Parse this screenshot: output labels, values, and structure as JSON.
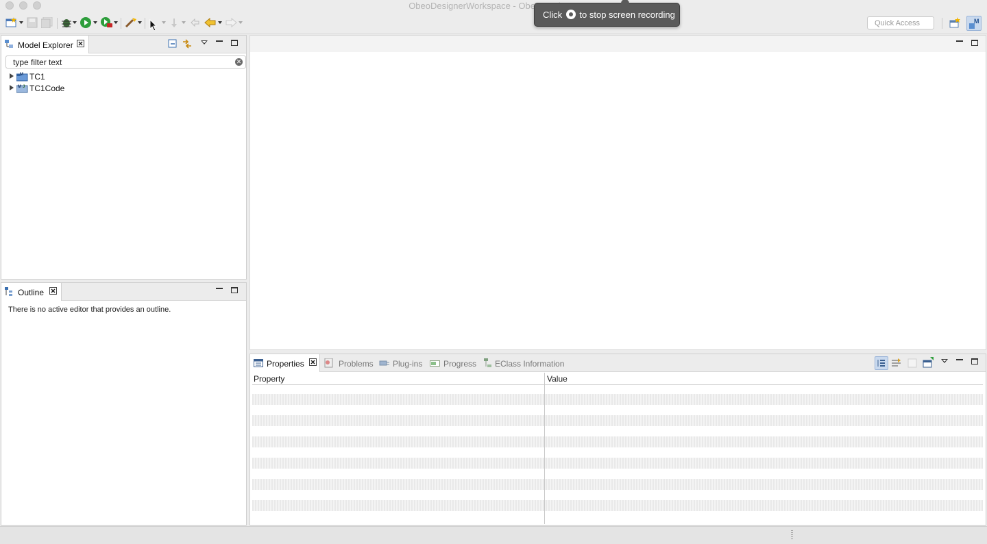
{
  "window": {
    "title": "ObeoDesignerWorkspace - Obeo Designer"
  },
  "recording_tip": {
    "before": "Click",
    "after": "to stop screen recording"
  },
  "toolbar": {
    "quick_access_placeholder": "Quick Access"
  },
  "model_explorer": {
    "tab_label": "Model Explorer",
    "filter_text": "type filter text",
    "items": [
      {
        "label": "TC1"
      },
      {
        "label": "TC1Code"
      }
    ]
  },
  "outline": {
    "tab_label": "Outline",
    "message": "There is no active editor that provides an outline."
  },
  "bottom_tabs": {
    "properties": "Properties",
    "problems": "Problems",
    "plugins": "Plug-ins",
    "progress": "Progress",
    "eclass_info": "EClass Information"
  },
  "properties_table": {
    "columns": [
      "Property",
      "Value"
    ]
  },
  "colors": {
    "accent": "#3a7fd4",
    "run_green": "#2e9e3c",
    "tooltip_bg": "#5a5a5a"
  }
}
